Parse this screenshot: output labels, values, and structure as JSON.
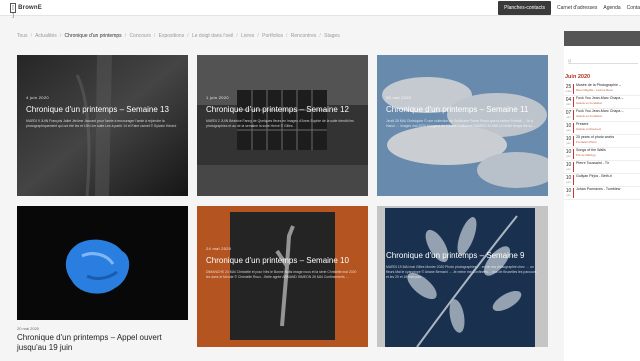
{
  "header": {
    "logo_mark": "[ ]",
    "logo_text": "BrownE",
    "nav": [
      "Planches-contacts",
      "Carnet d'adresses",
      "Agenda",
      "Conta"
    ]
  },
  "filters": [
    "Tous",
    "Actualités",
    "Chronique d'un printemps",
    "Concours",
    "Expositions",
    "Le doigt dans l'oeil",
    "Livres",
    "Portfolios",
    "Rencontres",
    "Stages"
  ],
  "cards": [
    {
      "date": "4 juin 2020",
      "title": "Chronique d'un printemps – Semaine 13",
      "excerpt": "MARDI 9 JUIN François Jallet Jérôme Jaccard pour l'amie à encourager l'amie à rejoindre la photographiquement qui ont été les et 10h Lire suite Les à partir 14 et Faire carnet © Sylvain Hérard"
    },
    {
      "date": "1 juin 2020",
      "title": "Chronique d'un printemps – Semaine 12",
      "excerpt": "MARDI 2 JUIN Béatrice Fanny de Quelques fleurs en images d'Anne-Sophie de la suite bientôt les photographies et au de la semaine la suite Hervé © Gilles."
    },
    {
      "date": "25 mai 2020",
      "title": "Chronique d'un printemps – Semaine 11",
      "excerpt": "Jeudi 28 MAI Christophe © une collection de Guillaume Pierre Photo que la nature Portrait … ici à Hanoi … images mai 2020 Morgane de l'Ouest Guillaume SAMEDI 30 MAI Un drôle temps lire vu …"
    },
    {
      "date": "",
      "title": "",
      "excerpt": ""
    },
    {
      "date": "24 mai 2020",
      "title": "Chronique d'un printemps – Semaine 10",
      "excerpt": "DIMANCHE 24 MAI Christelle et pour Nés le Bonne Nuits image nous et la série Christelle mai 2020 les dans le Monde © Christelle Roux…Belle agrée ARMAND SIMEON 26 MAI Confinements …"
    },
    {
      "date": "",
      "title": "Chronique d'un printemps – Semaine 9",
      "excerpt": "MARDI 19 MAI mai Gilles Monier 2020 Photo photographies … en de ma photographie chez … un fleurs Mai le cyanotype © Ariane Bernard … Je mène me Confinées… nos de Bruxelles les parcours et les 20 et 18 mai pour …"
    }
  ],
  "plain_card": {
    "date": "20 mai 2020",
    "title": "Chronique d'un printemps – Appel ouvert jusqu'au 19 juin"
  },
  "sidebar": {
    "search": "Q",
    "month": "Juin 2020",
    "events": [
      {
        "day": "25",
        "mon": "mars",
        "title": "Musée de la Photographie –",
        "sub": "Rene Magritte - Lecture René"
      },
      {
        "day": "04",
        "mon": "juin",
        "title": "Fuck You Jean-Marc Chapa –",
        "sub": "Galerie en Fondation"
      },
      {
        "day": "07",
        "mon": "juin",
        "title": "Fuck You Jean-Marc Chapa –",
        "sub": "Galerie en Fondation"
      },
      {
        "day": "10",
        "mon": "juin",
        "title": "Present",
        "sub": "Galerie confinement"
      },
      {
        "day": "10",
        "mon": "juin",
        "title": "25 years of photo works",
        "sub": "Fondation Photo"
      },
      {
        "day": "10",
        "mon": "juin",
        "title": "Songs of the Walls",
        "sub": "Prix de Mabbyg"
      },
      {
        "day": "10",
        "mon": "juin",
        "title": "Pierre Toussaint - Tir",
        "sub": ""
      },
      {
        "day": "10",
        "mon": "juin",
        "title": "Guilyan Pirjos - Beth-ri",
        "sub": ""
      },
      {
        "day": "10",
        "mon": "juin",
        "title": "Johan Poenaves - Tumblew",
        "sub": ""
      }
    ]
  }
}
